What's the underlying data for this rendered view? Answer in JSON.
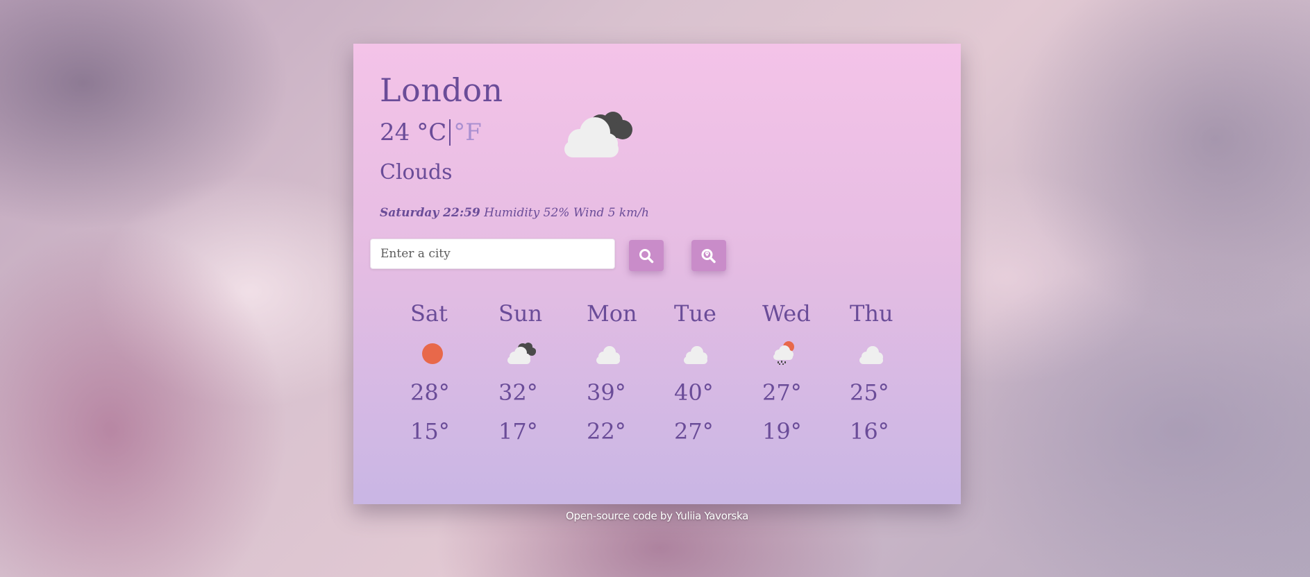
{
  "current": {
    "city": "London",
    "temperature": "24",
    "unit_celsius": "°C",
    "unit_fahrenheit": "°F",
    "description": "Clouds",
    "icon": "broken-clouds-icon",
    "day_time": "Saturday 22:59",
    "humidity": "Humidity 52%",
    "wind": "Wind 5 km/h"
  },
  "search": {
    "placeholder": "Enter a city",
    "value": "",
    "search_icon": "search-icon",
    "location_icon": "location-pin-icon"
  },
  "forecast": [
    {
      "day": "Sat",
      "icon": "sun-icon",
      "max": "28°",
      "min": "15°"
    },
    {
      "day": "Sun",
      "icon": "broken-clouds-icon",
      "max": "32°",
      "min": "17°"
    },
    {
      "day": "Mon",
      "icon": "cloud-icon",
      "max": "39°",
      "min": "22°"
    },
    {
      "day": "Tue",
      "icon": "cloud-icon",
      "max": "40°",
      "min": "27°"
    },
    {
      "day": "Wed",
      "icon": "sun-rain-cloud-icon",
      "max": "27°",
      "min": "19°"
    },
    {
      "day": "Thu",
      "icon": "cloud-icon",
      "max": "25°",
      "min": "16°"
    }
  ],
  "footer": {
    "text": "Open-source code by Yuliia Yavorska"
  },
  "colors": {
    "text": "#6a4c98",
    "accent": "#c98cc9",
    "sun": "#e8684a"
  }
}
